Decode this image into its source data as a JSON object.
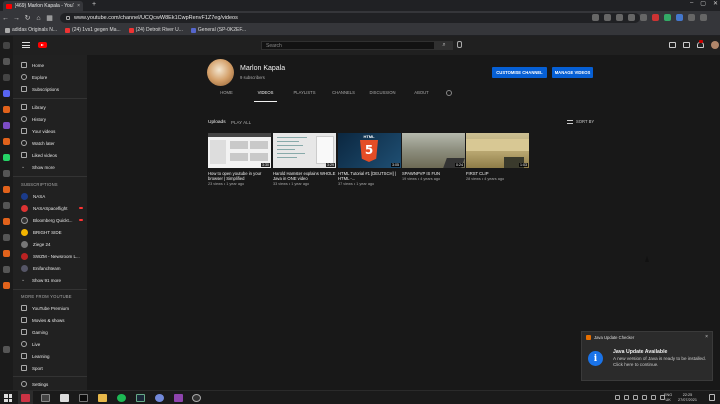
{
  "browser": {
    "tab_title": "(469) Marlon Kapala - YouT...",
    "tab_close": "×",
    "new_tab": "+",
    "url": "www.youtube.com/channel/UCQcwW8Ek1CwpRenvF1Z7eg/videos",
    "bookmarks": [
      {
        "label": "adidas Originals N..."
      },
      {
        "label": "(24) 1vs1 gegen Ma..."
      },
      {
        "label": "(24) Detroit River U..."
      },
      {
        "label": "General (SP-0K2EF..."
      }
    ]
  },
  "youtube": {
    "search_placeholder": "Search",
    "sidebar": {
      "main": [
        {
          "label": "Home"
        },
        {
          "label": "Explore"
        },
        {
          "label": "Subscriptions"
        }
      ],
      "library": [
        {
          "label": "Library"
        },
        {
          "label": "History"
        },
        {
          "label": "Your videos"
        },
        {
          "label": "Watch later"
        },
        {
          "label": "Liked videos"
        },
        {
          "label": "Show more"
        }
      ],
      "subscriptions_heading": "SUBSCRIPTIONS",
      "subscriptions": [
        {
          "label": "NASA",
          "color": "#1b3b8a"
        },
        {
          "label": "NASASpaceflight",
          "color": "#d33"
        },
        {
          "label": "Bloomberg Quickt...",
          "color": "#333"
        },
        {
          "label": "BRIGHT SIDE",
          "color": "#f2b400"
        },
        {
          "label": "Ziege 24",
          "color": "#777"
        },
        {
          "label": "SWZM - Newsroom L...",
          "color": "#b22"
        },
        {
          "label": "Enifanchteam",
          "color": "#556"
        },
        {
          "label": "Show 91 more",
          "color": ""
        }
      ],
      "more_heading": "MORE FROM YOUTUBE",
      "more": [
        {
          "label": "YouTube Premium"
        },
        {
          "label": "Movies & shows"
        },
        {
          "label": "Gaming"
        },
        {
          "label": "Live"
        },
        {
          "label": "Learning"
        },
        {
          "label": "Sport"
        }
      ],
      "settings": "Settings"
    },
    "channel": {
      "name": "Marlon Kapala",
      "subscribers": "9 subscribers",
      "customise_button": "CUSTOMISE CHANNEL",
      "manage_button": "MANAGE VIDEOS",
      "tabs": [
        "HOME",
        "VIDEOS",
        "PLAYLISTS",
        "CHANNELS",
        "DISCUSSION",
        "ABOUT"
      ],
      "active_tab": "VIDEOS"
    },
    "uploads_label": "Uploads",
    "play_all": "PLAY ALL",
    "sort_by": "SORT BY",
    "videos": [
      {
        "title": "How to open youtube in your browser | Simplified",
        "meta": "23 views • 1 year ago",
        "duration": "3:30"
      },
      {
        "title": "Harold Hamster explains WHOLE Java in ONE video",
        "meta": "33 views • 1 year ago",
        "duration": "3:29"
      },
      {
        "title": "HTML Tutorial #1 [DEUTSCH] | HTML -...",
        "meta": "37 views • 1 year ago",
        "duration": "3:05",
        "thumb_text": "HTML",
        "thumb_digit": "5"
      },
      {
        "title": "SPAWNPVP IS FUN",
        "meta": "19 views • 4 years ago",
        "duration": "0:24"
      },
      {
        "title": "FIRST CLIP",
        "meta": "28 views • 4 years ago",
        "duration": "1:03"
      }
    ]
  },
  "notification": {
    "app": "Java Update Checker",
    "title": "Java Update Available",
    "body": "A new version of Java is ready to be installed.",
    "action": "Click here to continue.",
    "close": "×"
  },
  "taskbar": {
    "language": "ENG\nUK",
    "time": "22:25",
    "date": "27/07/2021"
  },
  "colors": {
    "accent_blue": "#065fd4",
    "yt_red": "#ff0000",
    "bg": "#181818"
  }
}
